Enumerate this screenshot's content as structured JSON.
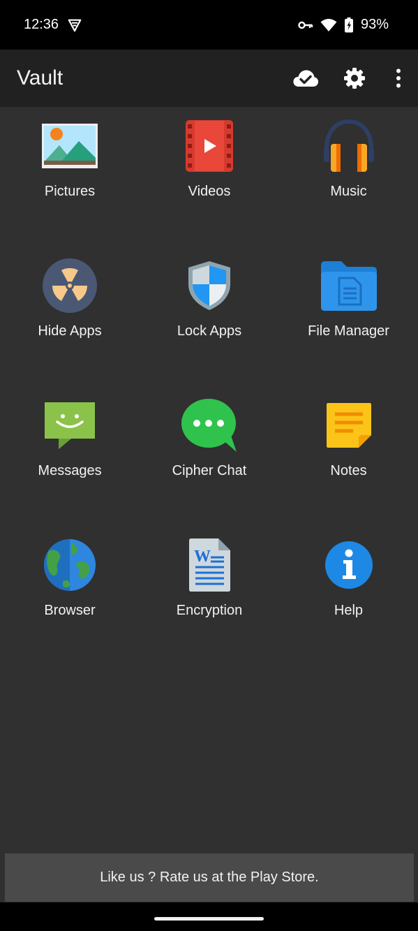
{
  "status_bar": {
    "time": "12:36",
    "notification_icon": "vpn-shield-icon",
    "status_icons": [
      "key-icon",
      "wifi-icon",
      "battery-icon"
    ],
    "battery": "93%"
  },
  "app_bar": {
    "title": "Vault",
    "actions": [
      "cloud-sync-icon",
      "settings-gear-icon",
      "more-vert-icon"
    ]
  },
  "tiles": [
    {
      "label": "Pictures",
      "icon": "pictures-icon"
    },
    {
      "label": "Videos",
      "icon": "videos-icon"
    },
    {
      "label": "Music",
      "icon": "music-headphones-icon"
    },
    {
      "label": "Hide Apps",
      "icon": "hide-apps-icon"
    },
    {
      "label": "Lock Apps",
      "icon": "lock-apps-shield-icon"
    },
    {
      "label": "File Manager",
      "icon": "file-manager-folder-icon"
    },
    {
      "label": "Messages",
      "icon": "messages-icon"
    },
    {
      "label": "Cipher Chat",
      "icon": "cipher-chat-icon"
    },
    {
      "label": "Notes",
      "icon": "notes-icon"
    },
    {
      "label": "Browser",
      "icon": "browser-globe-icon"
    },
    {
      "label": "Encryption",
      "icon": "encryption-document-icon"
    },
    {
      "label": "Help",
      "icon": "help-info-icon"
    }
  ],
  "rate_banner": {
    "text": "Like us ? Rate us at the Play Store."
  },
  "colors": {
    "background": "#303030",
    "app_bar": "#212121",
    "banner": "#4a4a4a"
  }
}
